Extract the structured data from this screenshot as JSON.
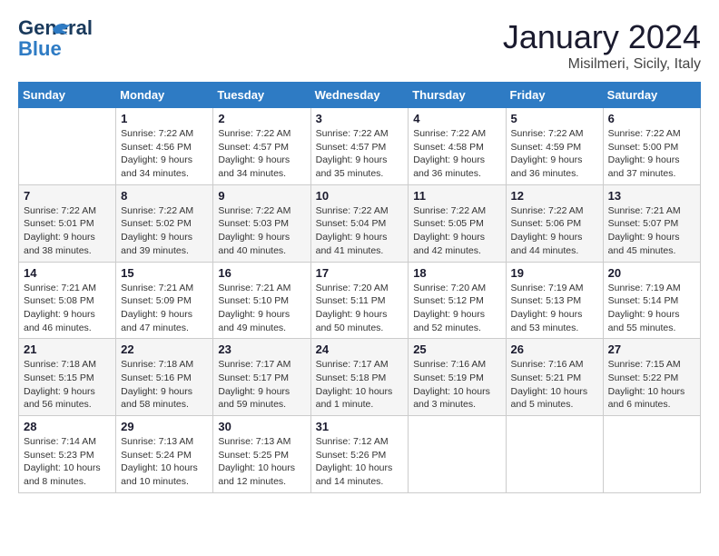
{
  "header": {
    "logo_general": "General",
    "logo_blue": "Blue",
    "title": "January 2024",
    "subtitle": "Misilmeri, Sicily, Italy"
  },
  "calendar": {
    "columns": [
      "Sunday",
      "Monday",
      "Tuesday",
      "Wednesday",
      "Thursday",
      "Friday",
      "Saturday"
    ],
    "weeks": [
      [
        {
          "day": "",
          "info": ""
        },
        {
          "day": "1",
          "info": "Sunrise: 7:22 AM\nSunset: 4:56 PM\nDaylight: 9 hours\nand 34 minutes."
        },
        {
          "day": "2",
          "info": "Sunrise: 7:22 AM\nSunset: 4:57 PM\nDaylight: 9 hours\nand 34 minutes."
        },
        {
          "day": "3",
          "info": "Sunrise: 7:22 AM\nSunset: 4:57 PM\nDaylight: 9 hours\nand 35 minutes."
        },
        {
          "day": "4",
          "info": "Sunrise: 7:22 AM\nSunset: 4:58 PM\nDaylight: 9 hours\nand 36 minutes."
        },
        {
          "day": "5",
          "info": "Sunrise: 7:22 AM\nSunset: 4:59 PM\nDaylight: 9 hours\nand 36 minutes."
        },
        {
          "day": "6",
          "info": "Sunrise: 7:22 AM\nSunset: 5:00 PM\nDaylight: 9 hours\nand 37 minutes."
        }
      ],
      [
        {
          "day": "7",
          "info": "Sunrise: 7:22 AM\nSunset: 5:01 PM\nDaylight: 9 hours\nand 38 minutes."
        },
        {
          "day": "8",
          "info": "Sunrise: 7:22 AM\nSunset: 5:02 PM\nDaylight: 9 hours\nand 39 minutes."
        },
        {
          "day": "9",
          "info": "Sunrise: 7:22 AM\nSunset: 5:03 PM\nDaylight: 9 hours\nand 40 minutes."
        },
        {
          "day": "10",
          "info": "Sunrise: 7:22 AM\nSunset: 5:04 PM\nDaylight: 9 hours\nand 41 minutes."
        },
        {
          "day": "11",
          "info": "Sunrise: 7:22 AM\nSunset: 5:05 PM\nDaylight: 9 hours\nand 42 minutes."
        },
        {
          "day": "12",
          "info": "Sunrise: 7:22 AM\nSunset: 5:06 PM\nDaylight: 9 hours\nand 44 minutes."
        },
        {
          "day": "13",
          "info": "Sunrise: 7:21 AM\nSunset: 5:07 PM\nDaylight: 9 hours\nand 45 minutes."
        }
      ],
      [
        {
          "day": "14",
          "info": "Sunrise: 7:21 AM\nSunset: 5:08 PM\nDaylight: 9 hours\nand 46 minutes."
        },
        {
          "day": "15",
          "info": "Sunrise: 7:21 AM\nSunset: 5:09 PM\nDaylight: 9 hours\nand 47 minutes."
        },
        {
          "day": "16",
          "info": "Sunrise: 7:21 AM\nSunset: 5:10 PM\nDaylight: 9 hours\nand 49 minutes."
        },
        {
          "day": "17",
          "info": "Sunrise: 7:20 AM\nSunset: 5:11 PM\nDaylight: 9 hours\nand 50 minutes."
        },
        {
          "day": "18",
          "info": "Sunrise: 7:20 AM\nSunset: 5:12 PM\nDaylight: 9 hours\nand 52 minutes."
        },
        {
          "day": "19",
          "info": "Sunrise: 7:19 AM\nSunset: 5:13 PM\nDaylight: 9 hours\nand 53 minutes."
        },
        {
          "day": "20",
          "info": "Sunrise: 7:19 AM\nSunset: 5:14 PM\nDaylight: 9 hours\nand 55 minutes."
        }
      ],
      [
        {
          "day": "21",
          "info": "Sunrise: 7:18 AM\nSunset: 5:15 PM\nDaylight: 9 hours\nand 56 minutes."
        },
        {
          "day": "22",
          "info": "Sunrise: 7:18 AM\nSunset: 5:16 PM\nDaylight: 9 hours\nand 58 minutes."
        },
        {
          "day": "23",
          "info": "Sunrise: 7:17 AM\nSunset: 5:17 PM\nDaylight: 9 hours\nand 59 minutes."
        },
        {
          "day": "24",
          "info": "Sunrise: 7:17 AM\nSunset: 5:18 PM\nDaylight: 10 hours\nand 1 minute."
        },
        {
          "day": "25",
          "info": "Sunrise: 7:16 AM\nSunset: 5:19 PM\nDaylight: 10 hours\nand 3 minutes."
        },
        {
          "day": "26",
          "info": "Sunrise: 7:16 AM\nSunset: 5:21 PM\nDaylight: 10 hours\nand 5 minutes."
        },
        {
          "day": "27",
          "info": "Sunrise: 7:15 AM\nSunset: 5:22 PM\nDaylight: 10 hours\nand 6 minutes."
        }
      ],
      [
        {
          "day": "28",
          "info": "Sunrise: 7:14 AM\nSunset: 5:23 PM\nDaylight: 10 hours\nand 8 minutes."
        },
        {
          "day": "29",
          "info": "Sunrise: 7:13 AM\nSunset: 5:24 PM\nDaylight: 10 hours\nand 10 minutes."
        },
        {
          "day": "30",
          "info": "Sunrise: 7:13 AM\nSunset: 5:25 PM\nDaylight: 10 hours\nand 12 minutes."
        },
        {
          "day": "31",
          "info": "Sunrise: 7:12 AM\nSunset: 5:26 PM\nDaylight: 10 hours\nand 14 minutes."
        },
        {
          "day": "",
          "info": ""
        },
        {
          "day": "",
          "info": ""
        },
        {
          "day": "",
          "info": ""
        }
      ]
    ]
  }
}
